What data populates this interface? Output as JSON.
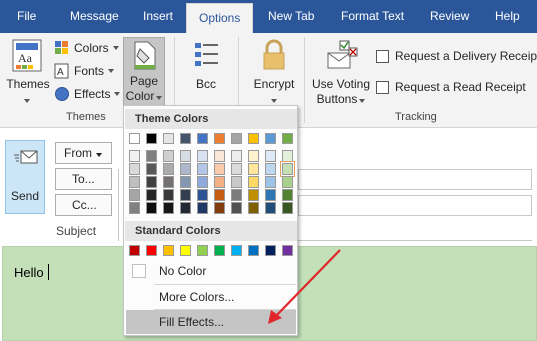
{
  "tabs": [
    {
      "label": "File",
      "active": false
    },
    {
      "label": "Message",
      "active": false
    },
    {
      "label": "Insert",
      "active": false
    },
    {
      "label": "Options",
      "active": true
    },
    {
      "label": "New Tab",
      "active": false
    },
    {
      "label": "Format Text",
      "active": false
    },
    {
      "label": "Review",
      "active": false
    },
    {
      "label": "Help",
      "active": false
    }
  ],
  "ribbon": {
    "themes": {
      "label": "Themes",
      "group_label": "Themes",
      "colors": "Colors",
      "fonts": "Fonts",
      "effects": "Effects"
    },
    "page_color": {
      "line1": "Page",
      "line2": "Color"
    },
    "bcc": "Bcc",
    "encrypt": "Encrypt",
    "voting": {
      "line1": "Use Voting",
      "line2": "Buttons"
    },
    "delivery_receipt": "Request a Delivery Receipt",
    "read_receipt": "Request a Read Receipt",
    "tracking_label": "Tracking"
  },
  "compose": {
    "send": "Send",
    "from": "From",
    "to": "To...",
    "cc": "Cc...",
    "subject": "Subject",
    "body_text": "Hello"
  },
  "dropdown": {
    "theme_header": "Theme Colors",
    "standard_header": "Standard Colors",
    "no_color": "No Color",
    "more_colors": "More Colors...",
    "fill_effects": "Fill Effects...",
    "theme_top": [
      "#ffffff",
      "#000000",
      "#e7e6e6",
      "#44546a",
      "#4472c4",
      "#ed7d31",
      "#a5a5a5",
      "#ffc000",
      "#5b9bd5",
      "#70ad47"
    ],
    "theme_cols": [
      [
        "#f2f2f2",
        "#d9d9d9",
        "#bfbfbf",
        "#a6a6a6",
        "#808080"
      ],
      [
        "#808080",
        "#595959",
        "#404040",
        "#262626",
        "#0d0d0d"
      ],
      [
        "#d0cece",
        "#aeabab",
        "#757171",
        "#3a3838",
        "#171616"
      ],
      [
        "#d6dce4",
        "#adb9ca",
        "#8497b0",
        "#333f4f",
        "#222a35"
      ],
      [
        "#d9e2f3",
        "#b4c6e7",
        "#8eaadb",
        "#2f5496",
        "#1f3864"
      ],
      [
        "#fbe5d6",
        "#f8cbad",
        "#f4b183",
        "#c55a11",
        "#843c0c"
      ],
      [
        "#ededed",
        "#dbdbdb",
        "#c9c9c9",
        "#7b7b7b",
        "#525252"
      ],
      [
        "#fff2cc",
        "#ffe699",
        "#ffd966",
        "#bf9000",
        "#7f6000"
      ],
      [
        "#deebf7",
        "#bdd7ee",
        "#9dc3e6",
        "#2e75b6",
        "#1f4e79"
      ],
      [
        "#e2f0d9",
        "#c5e0b4",
        "#a9d18e",
        "#548235",
        "#385723"
      ]
    ],
    "standard": [
      "#c00000",
      "#ff0000",
      "#ffc000",
      "#ffff00",
      "#92d050",
      "#00b050",
      "#00b0f0",
      "#0070c0",
      "#002060",
      "#7030a0"
    ],
    "selected_swatch": "#c5e0b4"
  },
  "colors": {
    "accent": "#2b579a",
    "page_fill": "#c3e0b8",
    "arrow": "#e0262a"
  }
}
